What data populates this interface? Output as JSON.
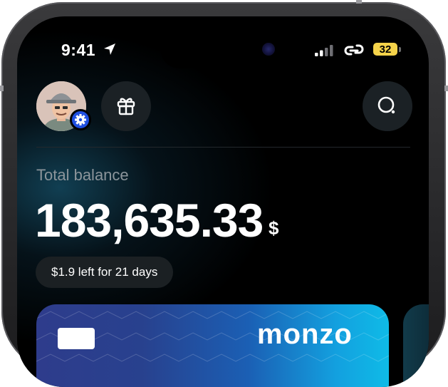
{
  "status_bar": {
    "time": "9:41",
    "battery_level": "32",
    "icons": [
      "location-arrow-icon",
      "cellular-signal-icon",
      "link-icon",
      "battery-icon"
    ]
  },
  "header": {
    "avatar": "user-avatar",
    "settings_badge_icon": "gear-icon",
    "gift_icon": "gift-icon",
    "search_icon": "search-icon"
  },
  "balance": {
    "label": "Total balance",
    "amount": "183,635.33",
    "currency": "$",
    "budget_note": "$1.9 left for 21 days"
  },
  "card": {
    "brand": "monzo",
    "chip_icon": "card-chip-icon"
  },
  "colors": {
    "background": "#000000",
    "accent_blue": "#1f4fe0",
    "battery_yellow": "#f5d34a",
    "muted_text": "#8c959b",
    "card_gradient_start": "#2e3c8c",
    "card_gradient_end": "#0fbbe7"
  }
}
